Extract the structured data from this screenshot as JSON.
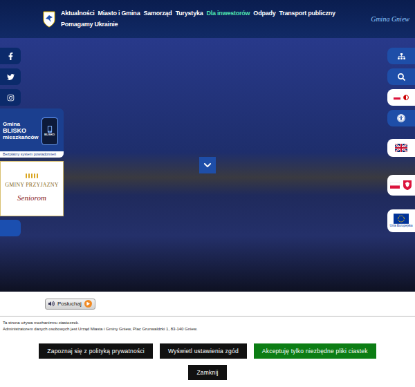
{
  "nav": {
    "items": [
      {
        "label": "Aktualności",
        "selected": false
      },
      {
        "label": "Miasto i Gmina",
        "selected": false
      },
      {
        "label": "Samorząd",
        "selected": false
      },
      {
        "label": "Turystyka",
        "selected": false
      },
      {
        "label": "Dla inwestorów",
        "selected": true
      },
      {
        "label": "Odpady",
        "selected": false
      },
      {
        "label": "Transport publiczny",
        "selected": false
      },
      {
        "label": "Pomagamy Ukrainie",
        "selected": false
      }
    ],
    "brand": "Gmina Gniew"
  },
  "blisko_banner": {
    "line1": "Gmina",
    "line2": "BLISKO",
    "line3": "mieszkańców",
    "phone_label": "BLISKO",
    "subtitle": "Bezpłatny system powiadomień"
  },
  "seniors_banner": {
    "top": "GMINY PRZYJAZNY",
    "bottom": "Seniorom"
  },
  "eu_label": "Unia Europejska",
  "listen_button": "Posłuchaj",
  "cookies": {
    "lines": [
      "Ta strona używa mechanizmu ciasteczek.",
      "Administratorem danych osobowych jest Urząd Miasta i Gminy Gniew, Plac Grunwaldzki 1, 83-140 Gniew."
    ],
    "buttons": [
      {
        "label": "Zapoznaj się z polityką prywatności",
        "kind": "dark"
      },
      {
        "label": "Wyświetl ustawienia zgód",
        "kind": "dark"
      },
      {
        "label": "Akceptuję tylko niezbędne pliki ciastek",
        "kind": "accept"
      }
    ],
    "close": "Zamknij"
  }
}
